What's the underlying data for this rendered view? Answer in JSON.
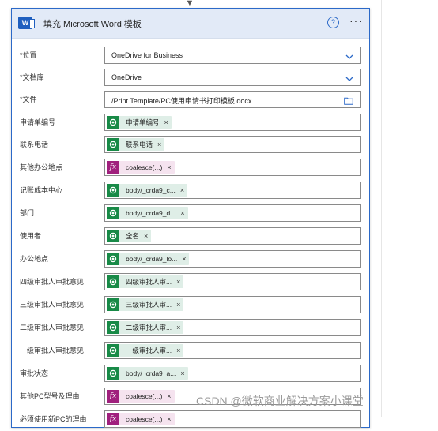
{
  "header": {
    "title": "填充 Microsoft Word 模板"
  },
  "fields": [
    {
      "label": "位置",
      "required": true,
      "kind": "dropdown",
      "value": "OneDrive for Business"
    },
    {
      "label": "文档库",
      "required": true,
      "kind": "dropdown",
      "value": "OneDrive"
    },
    {
      "label": "文件",
      "required": true,
      "kind": "file",
      "value": "/Print Template/PC使用申请书打印模板.docx"
    },
    {
      "label": "申请单编号",
      "required": false,
      "kind": "token",
      "token_type": "dynamic",
      "token": "申请单编号"
    },
    {
      "label": "联系电话",
      "required": false,
      "kind": "token",
      "token_type": "dynamic",
      "token": "联系电话"
    },
    {
      "label": "其他办公地点",
      "required": false,
      "kind": "token",
      "token_type": "expression",
      "token": "coalesce(...)"
    },
    {
      "label": "记账成本中心",
      "required": false,
      "kind": "token",
      "token_type": "dynamic",
      "token": "body/_crda9_c..."
    },
    {
      "label": "部门",
      "required": false,
      "kind": "token",
      "token_type": "dynamic",
      "token": "body/_crda9_d..."
    },
    {
      "label": "使用者",
      "required": false,
      "kind": "token",
      "token_type": "dynamic",
      "token": "全名"
    },
    {
      "label": "办公地点",
      "required": false,
      "kind": "token",
      "token_type": "dynamic",
      "token": "body/_crda9_lo..."
    },
    {
      "label": "四级审批人审批意见",
      "required": false,
      "kind": "token",
      "token_type": "dynamic",
      "token": "四级审批人审..."
    },
    {
      "label": "三级审批人审批意见",
      "required": false,
      "kind": "token",
      "token_type": "dynamic",
      "token": "三级审批人审..."
    },
    {
      "label": "二级审批人审批意见",
      "required": false,
      "kind": "token",
      "token_type": "dynamic",
      "token": "二级审批人审..."
    },
    {
      "label": "一级审批人审批意见",
      "required": false,
      "kind": "token",
      "token_type": "dynamic",
      "token": "一级审批人审..."
    },
    {
      "label": "审批状态",
      "required": false,
      "kind": "token",
      "token_type": "dynamic",
      "token": "body/_crda9_a..."
    },
    {
      "label": "其他PC型号及理由",
      "required": false,
      "kind": "token",
      "token_type": "expression",
      "token": "coalesce(...)"
    },
    {
      "label": "必须使用新PC的理由",
      "required": false,
      "kind": "token",
      "token_type": "expression",
      "token": "coalesce(...)"
    }
  ],
  "token_remove_glyph": "×",
  "required_marker": "*",
  "fx_glyph": "fx",
  "watermark": "CSDN @微软商业解决方案小课堂",
  "colors": {
    "accent": "#2b69c8",
    "dataverse_token": "#188a47",
    "expression_token": "#a0207d"
  },
  "icons": {
    "app": "word-icon",
    "help": "help-icon",
    "more": "more-icon",
    "dropdown": "chevron-down-icon",
    "file_picker": "folder-icon",
    "dynamic_token": "dataverse-icon",
    "expression_token": "fx-icon"
  }
}
